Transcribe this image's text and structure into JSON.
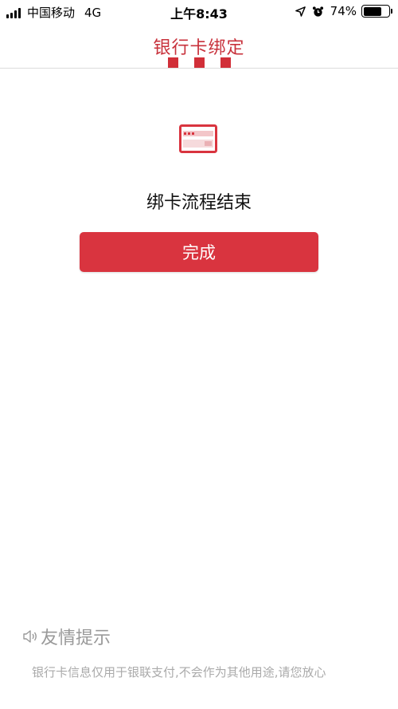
{
  "status_bar": {
    "carrier": "中国移动",
    "network": "4G",
    "time": "上午8:43",
    "battery_percent": "74%",
    "battery_level": 0.74
  },
  "header": {
    "title": "银行卡绑定",
    "steps_total": 3
  },
  "main": {
    "result_text": "绑卡流程结束",
    "done_button_label": "完成"
  },
  "tips": {
    "title": "友情提示",
    "text": "银行卡信息仅用于银联支付,不会作为其他用途,请您放心"
  },
  "colors": {
    "brand_red": "#d9343f",
    "title_red": "#c8323c",
    "hint_gray": "#aaaaaa"
  }
}
